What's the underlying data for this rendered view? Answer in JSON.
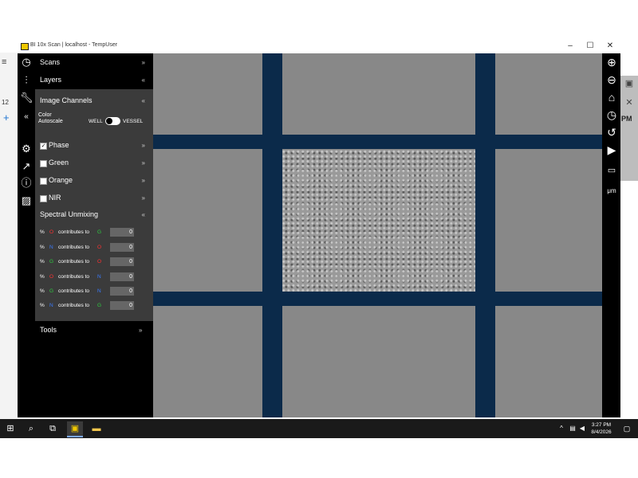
{
  "window": {
    "title": "BI 10x Scan | localhost - TempUser",
    "min": "‒",
    "max": "☐",
    "close": "✕"
  },
  "background_app": {
    "side_number": "12",
    "plus": "+",
    "pm": "PM"
  },
  "panel": {
    "scans": "Scans",
    "layers": "Layers",
    "image_channels": "Image Channels",
    "color_autoscale": "Color\nAutoscale",
    "toggle_left": "WELL",
    "toggle_right": "VESSEL",
    "channels": [
      {
        "label": "Phase",
        "checked": true
      },
      {
        "label": "Green",
        "checked": false
      },
      {
        "label": "Orange",
        "checked": false
      },
      {
        "label": "NIR",
        "checked": false
      }
    ],
    "spectral_unmixing": "Spectral Unmixing",
    "mix_rows": [
      {
        "from": "O",
        "to": "G",
        "value": "0"
      },
      {
        "from": "N",
        "to": "O",
        "value": "0"
      },
      {
        "from": "G",
        "to": "O",
        "value": "0"
      },
      {
        "from": "O",
        "to": "N",
        "value": "0"
      },
      {
        "from": "G",
        "to": "N",
        "value": "0"
      },
      {
        "from": "N",
        "to": "G",
        "value": "0"
      }
    ],
    "contributes": "contributes to",
    "pct": "%",
    "tools": "Tools",
    "chev_down": "»",
    "chev_up": "«",
    "collapse": "«"
  },
  "taskbar": {
    "time": "3:27 PM",
    "date": "8/4/2026"
  },
  "colors": {
    "lane": "#0b2a4a",
    "O": "#ff3030",
    "N": "#3a7bff",
    "G": "#2ecc40"
  }
}
